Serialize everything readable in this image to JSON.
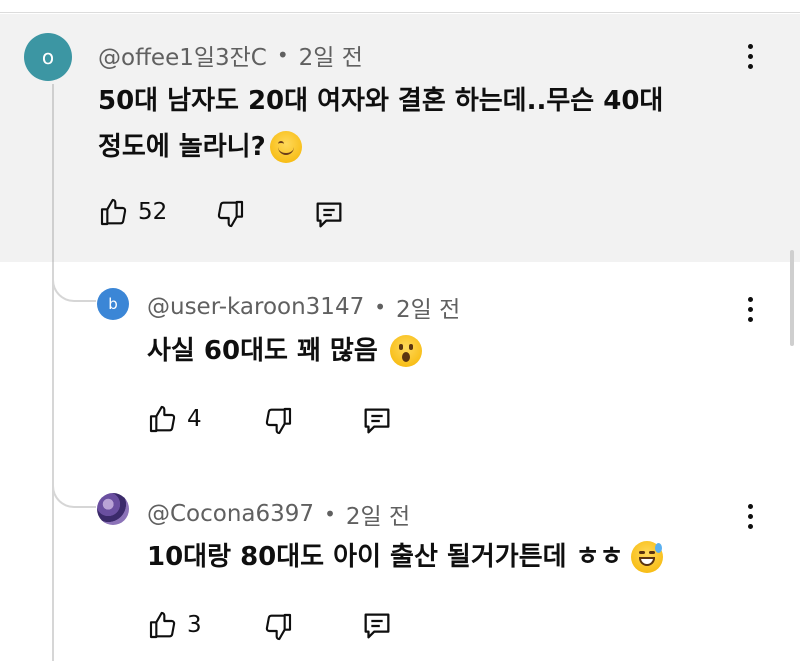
{
  "main_comment": {
    "avatar_letter": "o",
    "author": "@offee1일3잔C",
    "time": "2일 전",
    "text_line1": "50대 남자도 20대 여자와 결혼 하는데..무슨 40대",
    "text_line2": "정도에 놀라니?",
    "emoji": "smiling-face",
    "likes": "52"
  },
  "replies": [
    {
      "avatar_letter": "b",
      "author": "@user-karoon3147",
      "time": "2일 전",
      "text": "사실 60대도 꽤 많음",
      "emoji": "surprised-face",
      "likes": "4"
    },
    {
      "avatar_letter": "",
      "author": "@Cocona6397",
      "time": "2일 전",
      "text": "10대랑 80대도 아이 출산 될거가튼데 ㅎㅎ",
      "emoji": "sweat-smile-face",
      "likes": "3"
    }
  ],
  "separator": "•",
  "colors": {
    "main_bg": "#f2f2f2",
    "avatar_o": "#3c96a3",
    "avatar_b": "#3b86d6",
    "meta_text": "#606060"
  }
}
